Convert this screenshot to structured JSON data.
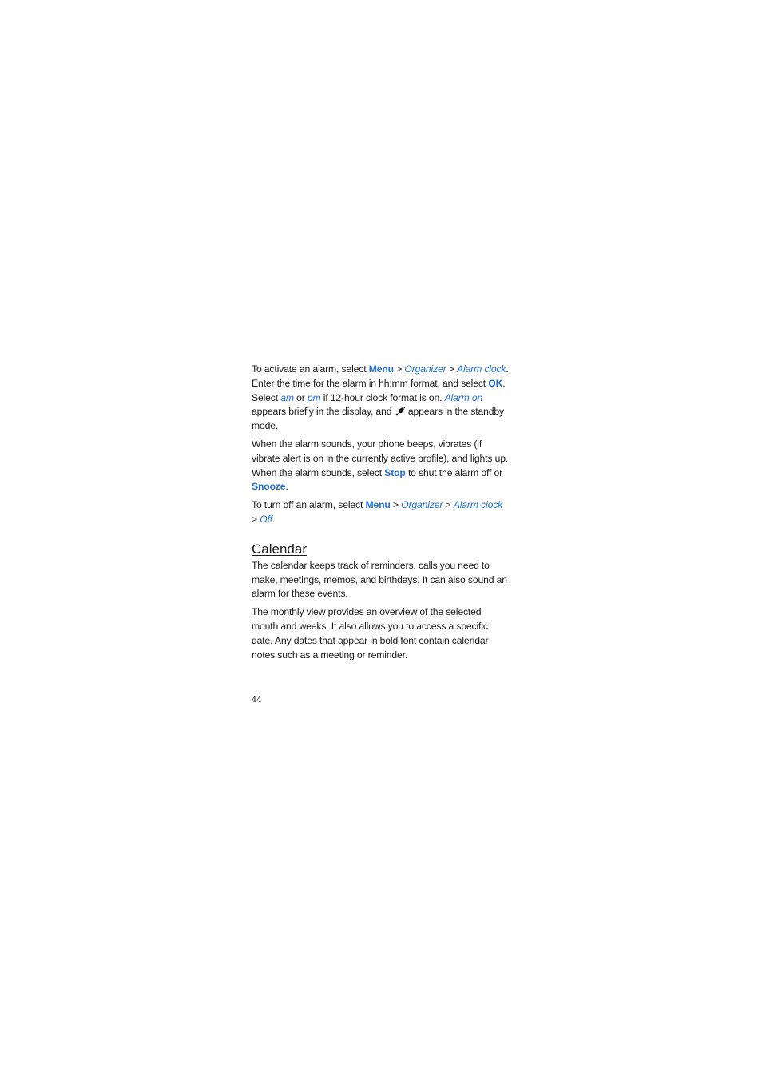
{
  "section1": {
    "p1": {
      "t1": "To activate an alarm, select ",
      "menu": "Menu",
      "sep1": " > ",
      "organizer": "Organizer",
      "sep2": " > ",
      "alarm_clock": "Alarm clock",
      "t2": ". Enter the time for the alarm in hh:mm format, and select ",
      "ok": "OK",
      "t3": ". Select ",
      "am": "am",
      "t4": " or ",
      "pm": "pm",
      "t5": " if 12-hour clock format is on. ",
      "alarm_on": "Alarm on",
      "t6": " appears briefly in the display, and ",
      "icon": "alarm-clock-icon",
      "t7": " appears in the standby mode."
    },
    "p2": {
      "t1": "When the alarm sounds, your phone beeps, vibrates (if vibrate alert is on in the currently active profile), and lights up. When the alarm sounds, select ",
      "stop": "Stop",
      "t2": " to shut the alarm off or ",
      "snooze": "Snooze",
      "t3": "."
    },
    "p3": {
      "t1": "To turn off an alarm, select ",
      "menu": "Menu",
      "sep1": " > ",
      "organizer": "Organizer",
      "sep2": " > ",
      "alarm_clock": "Alarm clock",
      "sep3": " > ",
      "off": "Off",
      "t2": "."
    }
  },
  "calendar": {
    "heading": "Calendar",
    "p1": "The calendar keeps track of reminders, calls you need to make, meetings, memos, and birthdays. It can also sound an alarm for these events.",
    "p2": "The monthly view provides an overview of the selected month and weeks. It also allows you to access a specific date. Any dates that appear in bold font contain calendar notes such as a meeting or reminder."
  },
  "page_number": "44",
  "colors": {
    "link": "#1f6fd6",
    "text": "#1a1a1a"
  }
}
